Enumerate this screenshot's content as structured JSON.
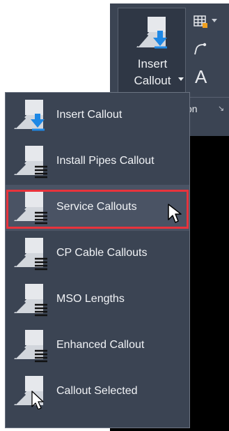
{
  "ribbon": {
    "insert_callout_line1": "Insert",
    "insert_callout_line2": "Callout",
    "text_tool_letter": "A",
    "panel_label": "on",
    "launcher_glyph": "↘"
  },
  "menu": {
    "items": [
      {
        "label": "Insert Callout",
        "icon": "insert-callout-icon"
      },
      {
        "label": "Install Pipes Callout",
        "icon": "callout-icon"
      },
      {
        "label": "Service Callouts",
        "icon": "callout-icon"
      },
      {
        "label": "CP Cable Callouts",
        "icon": "callout-icon"
      },
      {
        "label": "MSO Lengths",
        "icon": "callout-icon"
      },
      {
        "label": "Enhanced Callout",
        "icon": "callout-icon"
      },
      {
        "label": "Callout Selected",
        "icon": "callout-selected-icon"
      }
    ],
    "hovered_index": 2
  },
  "colors": {
    "panel_bg": "#3b4453",
    "highlight": "#e8333c",
    "text": "#f1f3f6",
    "accent_blue": "#1e88e5"
  }
}
